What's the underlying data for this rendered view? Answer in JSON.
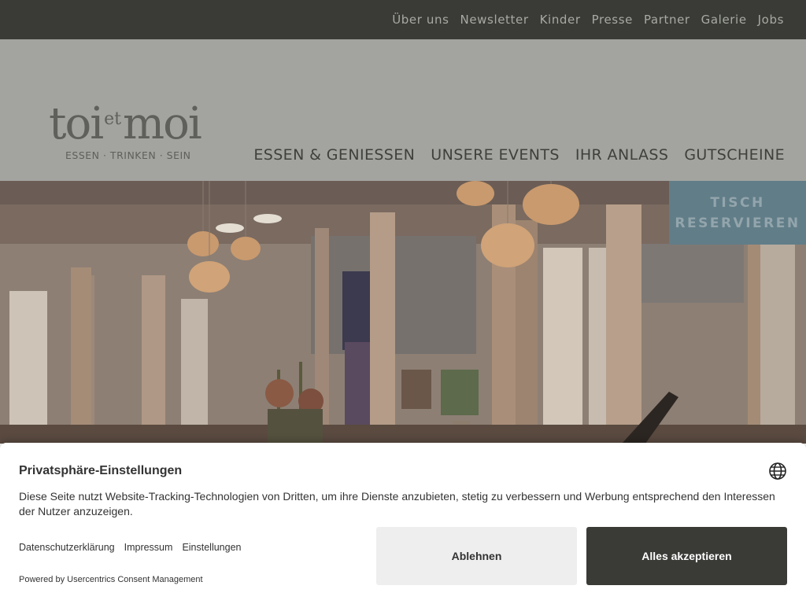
{
  "topnav": {
    "items": [
      "Über uns",
      "Newsletter",
      "Kinder",
      "Presse",
      "Partner",
      "Galerie",
      "Jobs"
    ]
  },
  "logo": {
    "wordmark": "toietmoi",
    "word_toi": "toi",
    "word_et": "et",
    "word_moi": "moi",
    "tagline": "ESSEN · TRINKEN · SEIN"
  },
  "mainnav": {
    "items": [
      "ESSEN & GENIESSEN",
      "UNSERE EVENTS",
      "IHR ANLASS",
      "GUTSCHEINE"
    ]
  },
  "reserve": {
    "line1": "TISCH",
    "line2": "RESERVIEREN"
  },
  "consent": {
    "title": "Privatsphäre-Einstellungen",
    "text": "Diese Seite nutzt Website-Tracking-Technologien von Dritten, um ihre Dienste anzubieten, stetig zu verbessern und Werbung entsprechend den Interessen der Nutzer anzuzeigen.",
    "links": [
      "Datenschutzerklärung",
      "Impressum",
      "Einstellungen"
    ],
    "deny_label": "Ablehnen",
    "accept_label": "Alles akzeptieren",
    "powered_by": "Powered by Usercentrics Consent Management",
    "language_icon": "globe-icon"
  },
  "colors": {
    "topbar": "#3a3b36",
    "header_overlay": "#a3a4a0",
    "reserve_button": "#617d88",
    "accept_button": "#3a3b36",
    "deny_button": "#eeeeee"
  }
}
